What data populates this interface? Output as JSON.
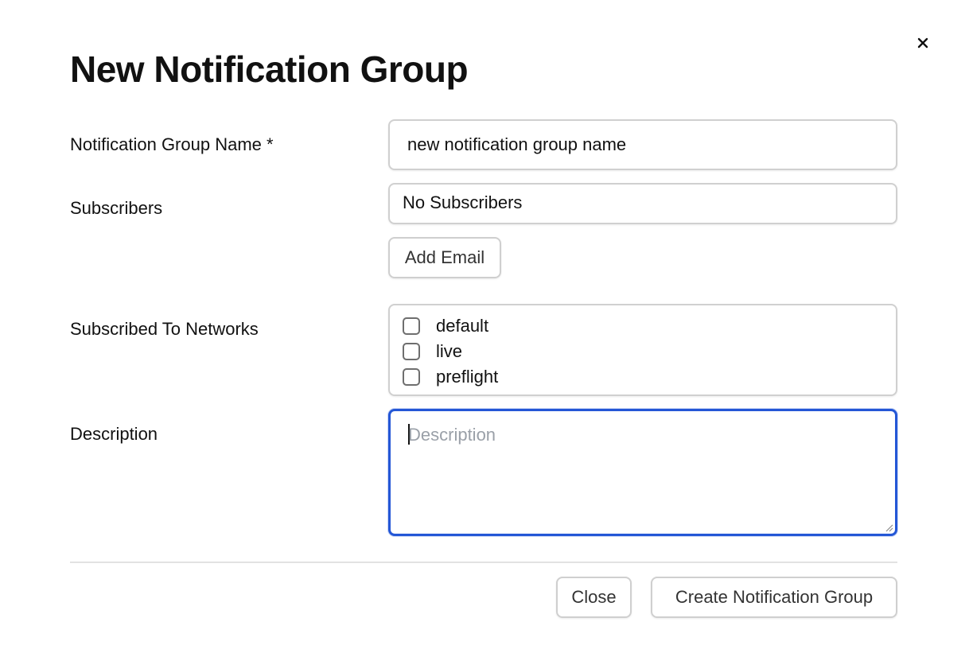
{
  "dialog": {
    "title": "New Notification Group",
    "close_icon": "close-icon"
  },
  "form": {
    "name": {
      "label": "Notification Group Name *",
      "value": "new notification group name"
    },
    "subscribers": {
      "label": "Subscribers",
      "value": "No Subscribers",
      "add_button": "Add Email"
    },
    "networks": {
      "label": "Subscribed To Networks",
      "options": [
        {
          "label": "default",
          "checked": false
        },
        {
          "label": "live",
          "checked": false
        },
        {
          "label": "preflight",
          "checked": false
        }
      ]
    },
    "description": {
      "label": "Description",
      "placeholder": "Description",
      "value": ""
    }
  },
  "footer": {
    "close_label": "Close",
    "create_label": "Create Notification Group"
  },
  "colors": {
    "focus_border": "#2457d6",
    "placeholder": "#9aa0a8"
  }
}
